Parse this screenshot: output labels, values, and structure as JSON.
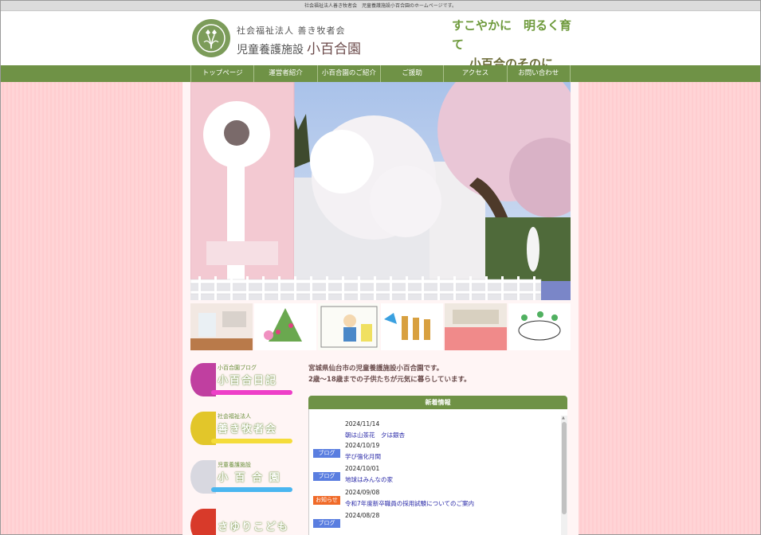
{
  "top_bar": {
    "text": "社会福祉法人善き牧者会　児童養護施設小百合園のホームページです。"
  },
  "header": {
    "org_name": "社会福祉法人 善き牧者会",
    "facility_type": "児童養護施設",
    "facility_name": "小百合園",
    "slogan_line1": "すこやかに　明るく育て",
    "slogan_line2": "小百合のそのに"
  },
  "nav": {
    "items": [
      {
        "label": "トップページ"
      },
      {
        "label": "運営者紹介"
      },
      {
        "label": "小百合園のご紹介"
      },
      {
        "label": "ご援助"
      },
      {
        "label": "アクセス"
      },
      {
        "label": "お問い合わせ"
      }
    ]
  },
  "banners": [
    {
      "small": "小百合園ブログ",
      "big": "小百合日記",
      "bar_color": "#ee3fc8",
      "flower_color": "#c03fa0"
    },
    {
      "small": "社会福祉法人",
      "big": "善き牧者会",
      "bar_color": "#f5dc3a",
      "flower_color": "#e2c62a"
    },
    {
      "small": "児童養護施設",
      "big": "小 百 合 園",
      "bar_color": "#4ab6f0",
      "flower_color": "#e8e8f0"
    },
    {
      "small": "",
      "big": "さゆりこども園",
      "bar_color": "#f07a2a",
      "flower_color": "#d83a2a"
    }
  ],
  "intro": {
    "line1": "宮城県仙台市の児童養護施設小百合園です。",
    "line2": "2歳～18歳までの子供たちが元気に暮らしています。"
  },
  "news": {
    "title": "新着情報",
    "entries": [
      {
        "tag": "",
        "tag_color": "",
        "date": "2024/11/14",
        "title": "朝は山茶花　夕は銀杏"
      },
      {
        "tag": "ブログ",
        "tag_color": "#5a7ee0",
        "date": "2024/10/19",
        "title": "学び強化月間"
      },
      {
        "tag": "ブログ",
        "tag_color": "#5a7ee0",
        "date": "2024/10/01",
        "title": "地球はみんなの家"
      },
      {
        "tag": "お知らせ",
        "tag_color": "#f06a28",
        "date": "2024/09/08",
        "title": "令和7年度新卒職員の採用試験についてのご案内"
      },
      {
        "tag": "ブログ",
        "tag_color": "#5a7ee0",
        "date": "2024/08/28",
        "title": ""
      }
    ]
  },
  "colors": {
    "nav_green": "#6f9246",
    "body_pink": "#ffd4d6",
    "blog_tag": "#5a7ee0",
    "notice_tag": "#f06a28"
  }
}
